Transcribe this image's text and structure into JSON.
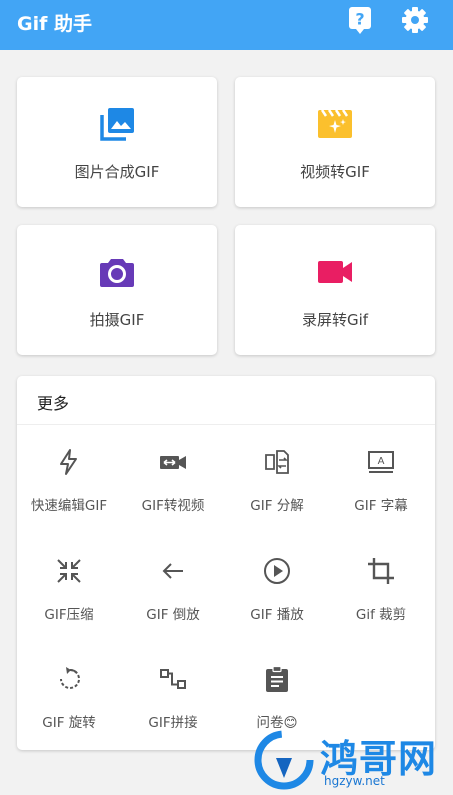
{
  "appbar": {
    "title": "Gif 助手",
    "help_icon": "help-icon",
    "settings_icon": "gear-icon",
    "background": "#42a5f5"
  },
  "cards": [
    {
      "label": "图片合成GIF",
      "icon": "image-icon",
      "color": "#1e88e5"
    },
    {
      "label": "视频转GIF",
      "icon": "movie-clapper-icon",
      "color": "#fbc02d"
    },
    {
      "label": "拍摄GIF",
      "icon": "camera-icon",
      "color": "#673ab7"
    },
    {
      "label": "录屏转Gif",
      "icon": "video-camera-icon",
      "color": "#e91e63"
    }
  ],
  "more": {
    "title": "更多",
    "tools": [
      {
        "label": "快速编辑GIF",
        "icon": "flash-icon"
      },
      {
        "label": "GIF转视频",
        "icon": "video-convert-icon"
      },
      {
        "label": "GIF 分解",
        "icon": "split-file-icon"
      },
      {
        "label": "GIF 字幕",
        "icon": "subtitle-icon"
      },
      {
        "label": "GIF压缩",
        "icon": "compress-icon"
      },
      {
        "label": "GIF 倒放",
        "icon": "reverse-arrow-icon"
      },
      {
        "label": "GIF 播放",
        "icon": "play-circle-icon"
      },
      {
        "label": "Gif 裁剪",
        "icon": "crop-icon"
      },
      {
        "label": "GIF 旋转",
        "icon": "rotate-icon"
      },
      {
        "label": "GIF拼接",
        "icon": "join-icon"
      },
      {
        "label": "问卷😊",
        "icon": "clipboard-icon"
      }
    ]
  },
  "watermark": {
    "text": "鸿哥网",
    "url": "hgzyw.net"
  }
}
